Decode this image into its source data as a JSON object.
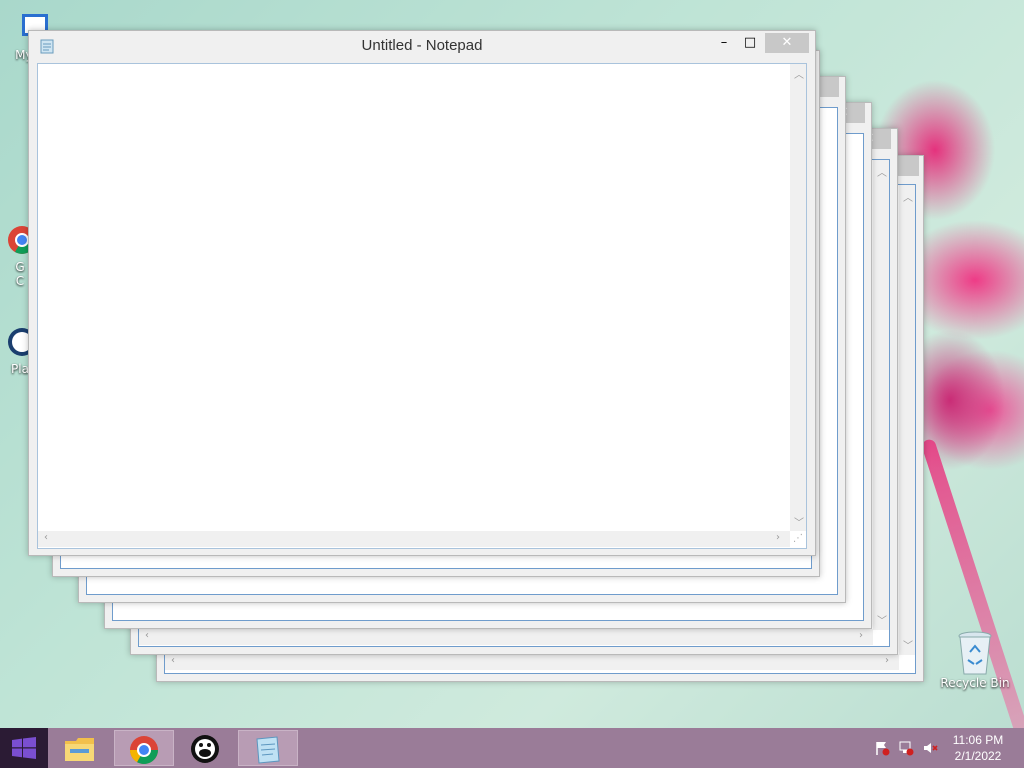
{
  "desktop": {
    "icons": [
      {
        "label": "My C"
      },
      {
        "label": "G\nC"
      },
      {
        "label": "Pla"
      },
      {
        "label": "Recycle Bin"
      }
    ]
  },
  "notepad": {
    "title": "Untitled - Notepad",
    "minimize_glyph": "–",
    "maximize_glyph": "□",
    "close_glyph": "✕",
    "content": ""
  },
  "taskbar": {
    "items": [
      {
        "name": "start",
        "icon": "windows-logo-icon"
      },
      {
        "name": "file-explorer",
        "icon": "folder-icon"
      },
      {
        "name": "chrome",
        "icon": "chrome-icon"
      },
      {
        "name": "app",
        "icon": "app-face-icon"
      },
      {
        "name": "notepad",
        "icon": "notepad-icon"
      }
    ],
    "time": "11:06 PM",
    "date": "2/1/2022"
  },
  "colors": {
    "accent": "#6f9ccc",
    "taskbar": "#9a7c98",
    "start": "#2b1b34"
  }
}
